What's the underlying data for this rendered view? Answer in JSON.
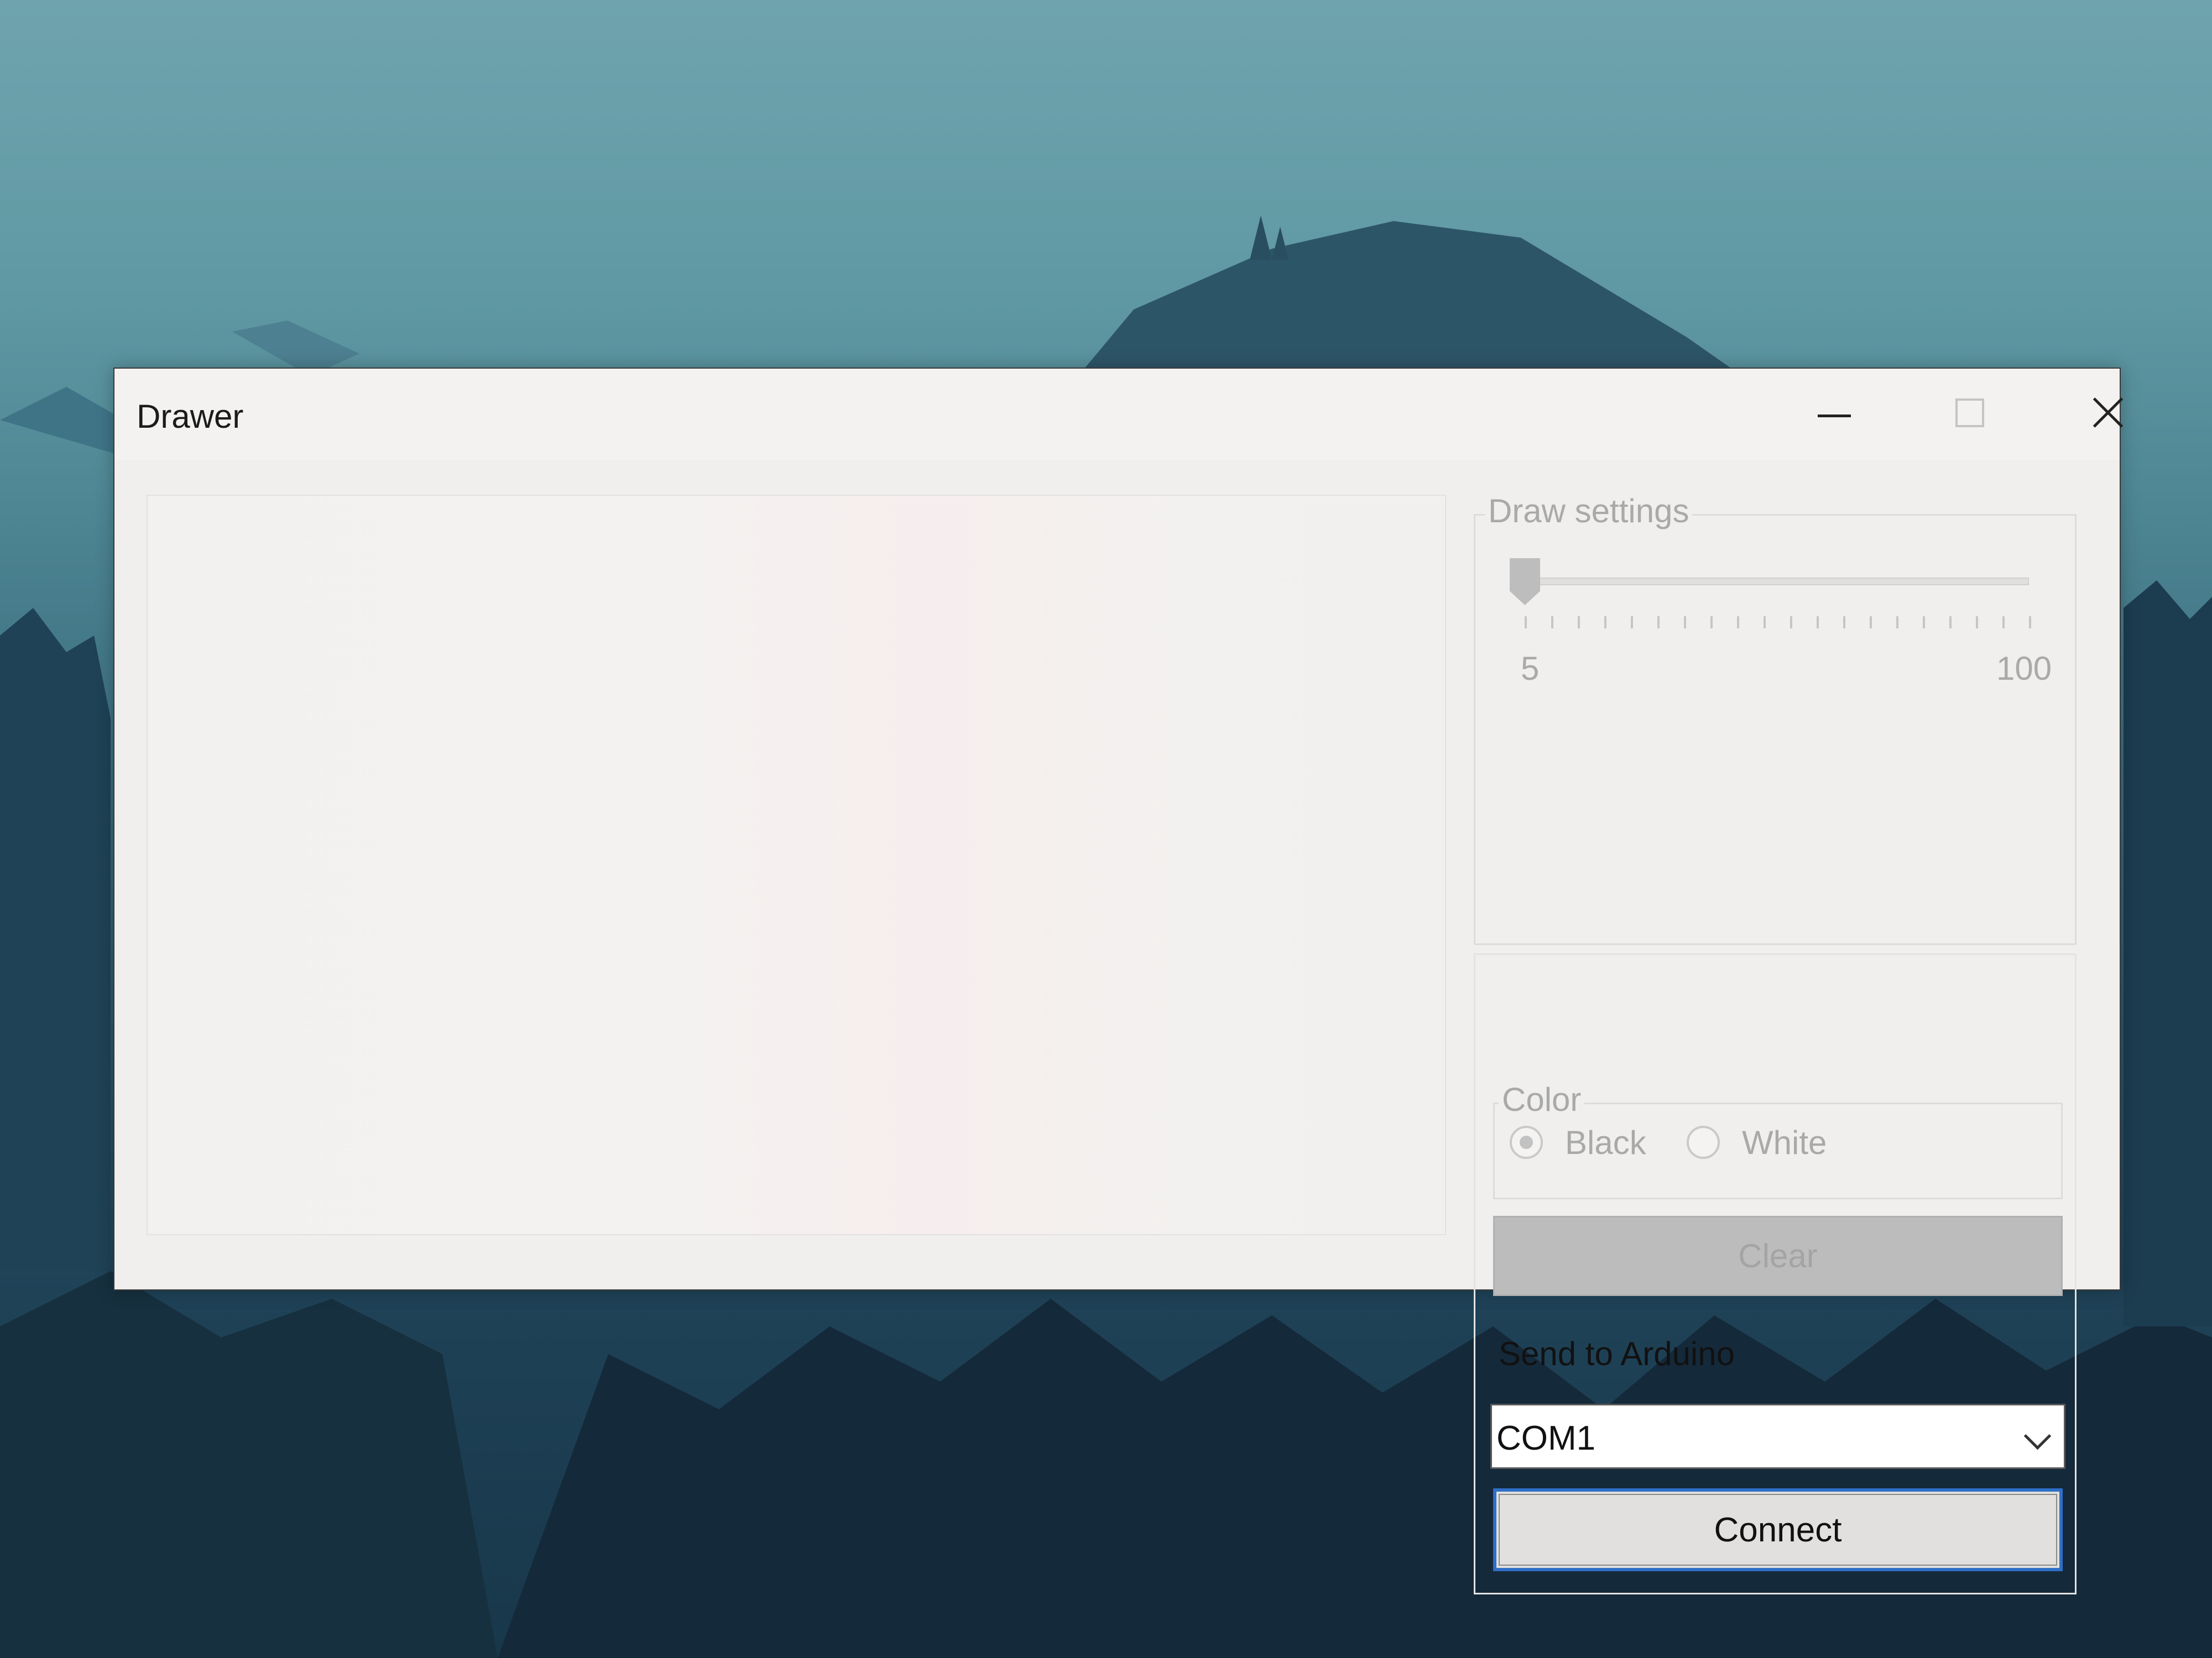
{
  "window": {
    "title": "Drawer",
    "controls": {
      "minimize": "minimize-icon",
      "maximize": "maximize-icon",
      "close": "close-icon"
    }
  },
  "draw_settings": {
    "group_label": "Draw settings",
    "slider": {
      "min_label": "5",
      "max_label": "100",
      "value": 5
    },
    "color_group": {
      "label": "Color",
      "options": [
        {
          "label": "Black",
          "checked": true
        },
        {
          "label": "White",
          "checked": false
        }
      ]
    },
    "clear_label": "Clear"
  },
  "arduino": {
    "label": "Send to Arduino",
    "port_selected": "COM1",
    "connect_label": "Connect"
  },
  "colors": {
    "focus_border": "#2f6fc6",
    "disabled_text": "#a9a9a9"
  }
}
